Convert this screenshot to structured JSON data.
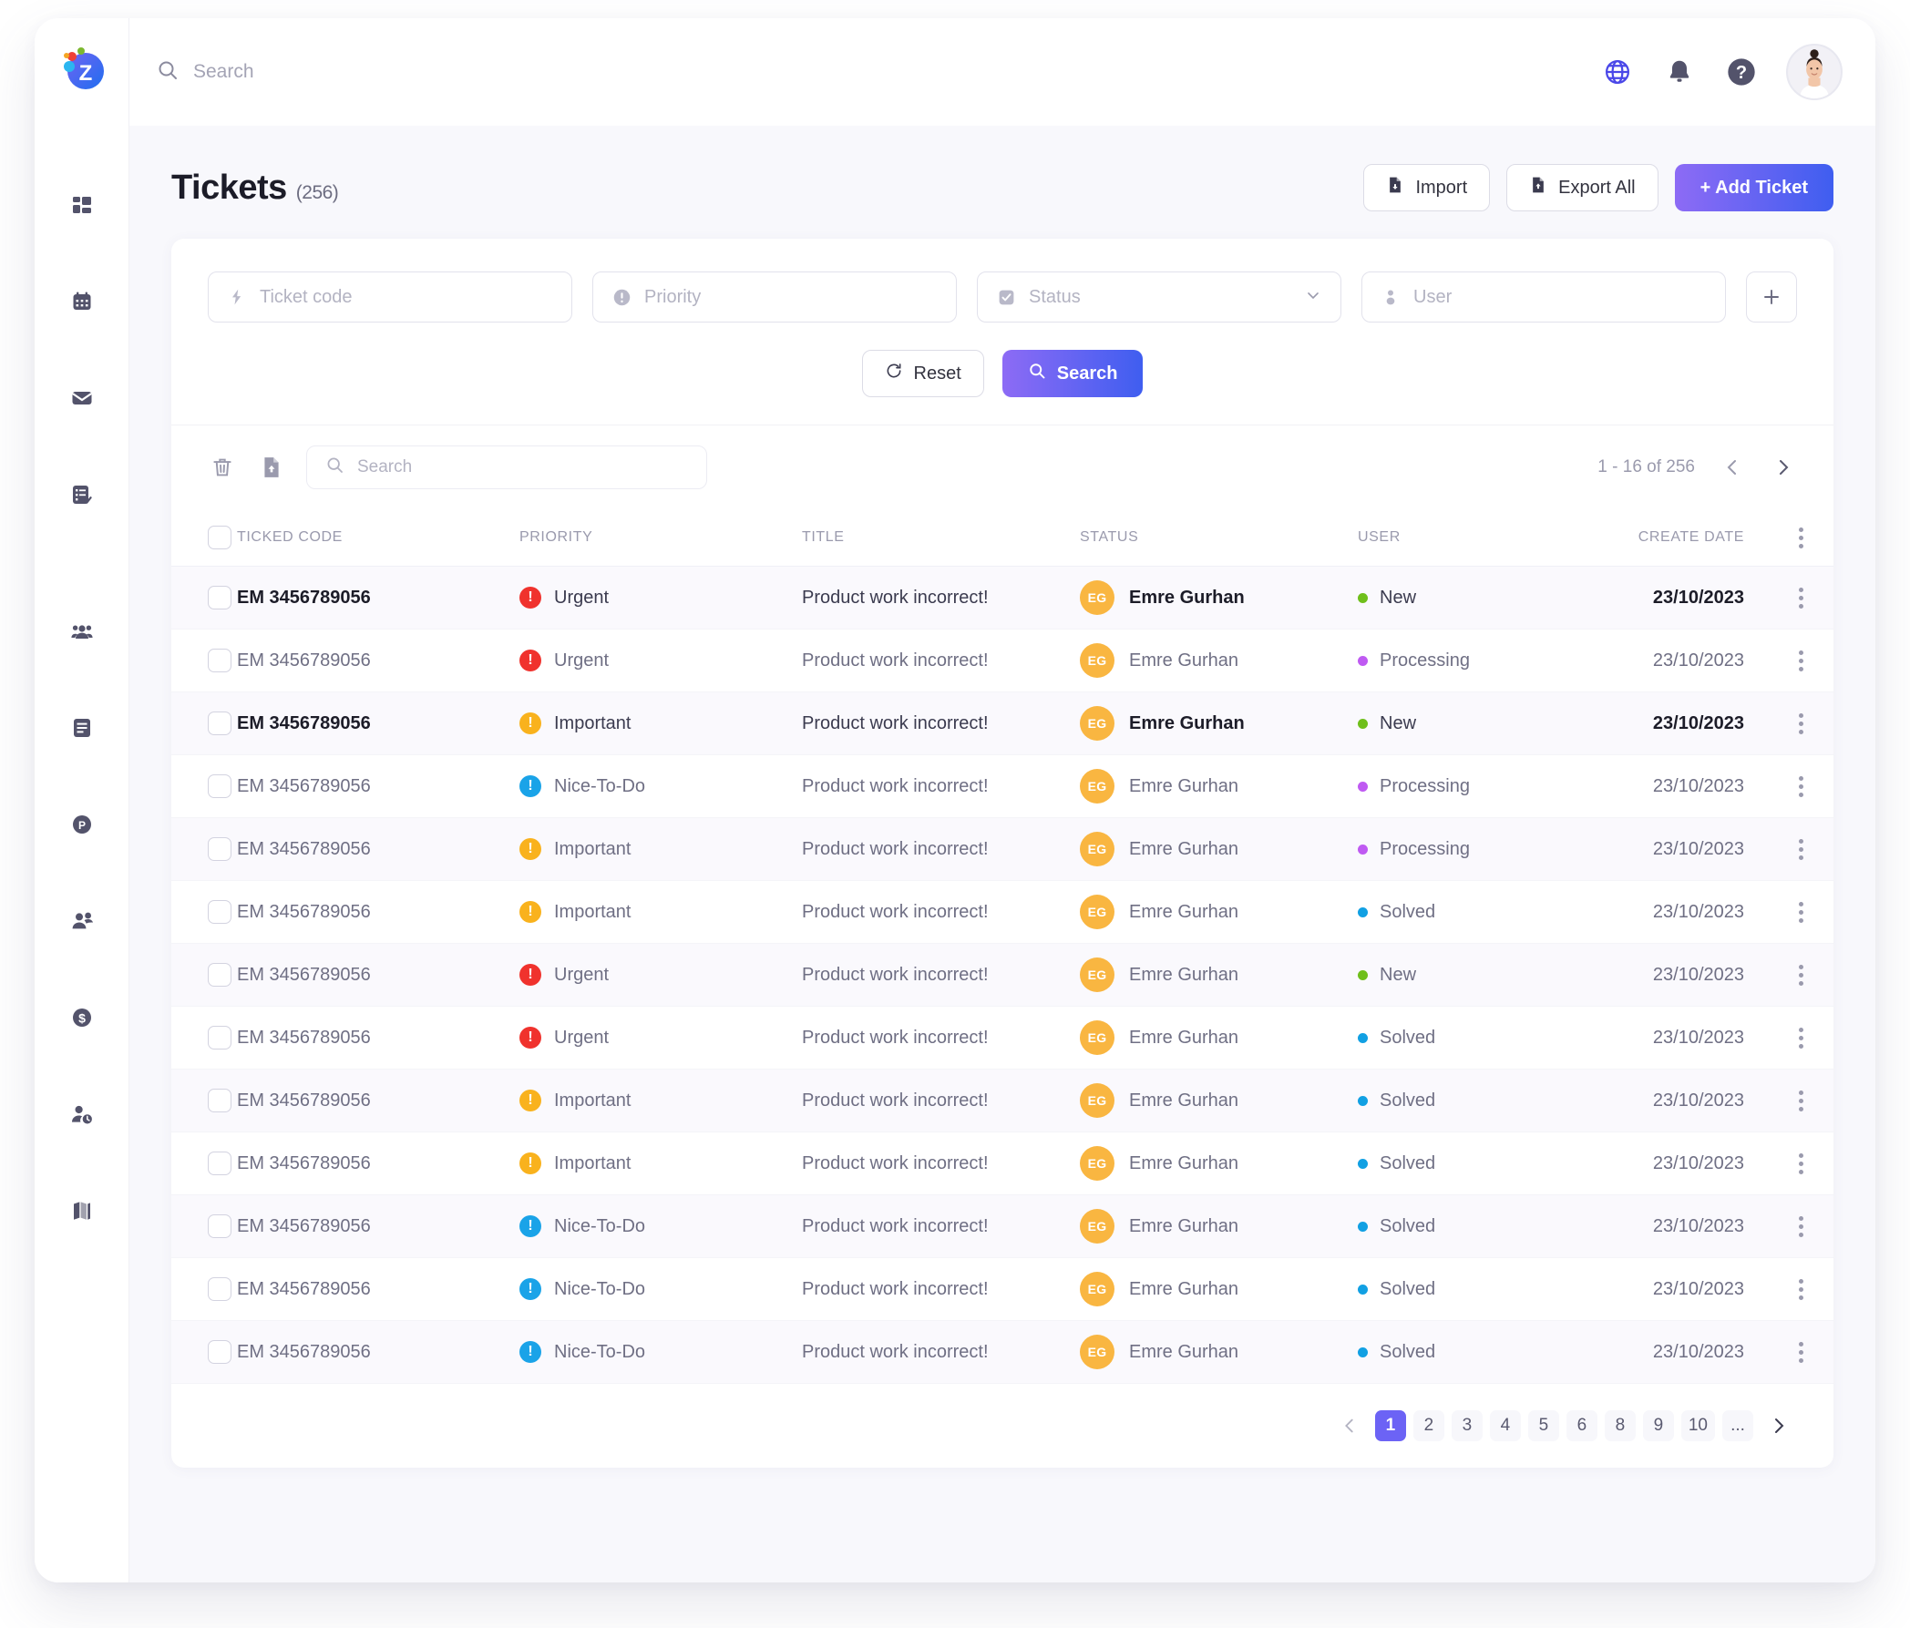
{
  "brand": {
    "logo_letter": "Z",
    "accent": "#3f5ef0",
    "accent2": "#8d6bf5"
  },
  "topbar": {
    "search_placeholder": "Search",
    "icons": [
      "globe-icon",
      "bell-icon",
      "help-icon"
    ]
  },
  "sidebar": {
    "items": [
      {
        "name": "dashboard",
        "icon": "dashboard-icon"
      },
      {
        "name": "calendar",
        "icon": "calendar-icon"
      },
      {
        "name": "mail",
        "icon": "mail-icon"
      },
      {
        "name": "tasks",
        "icon": "task-list-icon"
      },
      {
        "name": "teams",
        "icon": "users-group-icon"
      },
      {
        "name": "documents",
        "icon": "document-icon"
      },
      {
        "name": "projects",
        "icon": "p-circle-icon"
      },
      {
        "name": "contacts",
        "icon": "user-add-icon"
      },
      {
        "name": "finance",
        "icon": "dollar-circle-icon"
      },
      {
        "name": "user-settings",
        "icon": "user-clock-icon"
      },
      {
        "name": "map",
        "icon": "map-icon"
      }
    ]
  },
  "page": {
    "title": "Tickets",
    "count": "(256)",
    "import_label": "Import",
    "export_label": "Export All",
    "add_label": "+ Add Ticket"
  },
  "filters": {
    "ticket_code_placeholder": "Ticket code",
    "priority_placeholder": "Priority",
    "status_placeholder": "Status",
    "user_placeholder": "User",
    "add_filter_label": "+",
    "reset_label": "Reset",
    "search_label": "Search"
  },
  "table_toolbar": {
    "search_placeholder": "Search",
    "range_text": "1 - 16 of 256"
  },
  "table": {
    "headers": [
      "TICKED CODE",
      "PRIORITY",
      "TITLE",
      "STATUS",
      "USER",
      "CREATE DATE"
    ],
    "priority_colors": {
      "Urgent": "#f0322d",
      "Important": "#f9b21d",
      "Nice-To-Do": "#1aa3e8"
    },
    "status_colors": {
      "New": "#6fbf1b",
      "Processing": "#bf5af2",
      "Solved": "#11a0e3"
    },
    "rows": [
      {
        "code": "EM 3456789056",
        "priority": "Urgent",
        "title": "Product work incorrect!",
        "user": "Emre Gurhan",
        "initials": "EG",
        "status": "New",
        "date": "23/10/2023",
        "bold": true,
        "alt": true
      },
      {
        "code": "EM 3456789056",
        "priority": "Urgent",
        "title": "Product work incorrect!",
        "user": "Emre Gurhan",
        "initials": "EG",
        "status": "Processing",
        "date": "23/10/2023",
        "bold": false,
        "alt": false
      },
      {
        "code": "EM 3456789056",
        "priority": "Important",
        "title": "Product work incorrect!",
        "user": "Emre Gurhan",
        "initials": "EG",
        "status": "New",
        "date": "23/10/2023",
        "bold": true,
        "alt": true
      },
      {
        "code": "EM 3456789056",
        "priority": "Nice-To-Do",
        "title": "Product work incorrect!",
        "user": "Emre Gurhan",
        "initials": "EG",
        "status": "Processing",
        "date": "23/10/2023",
        "bold": false,
        "alt": false
      },
      {
        "code": "EM 3456789056",
        "priority": "Important",
        "title": "Product work incorrect!",
        "user": "Emre Gurhan",
        "initials": "EG",
        "status": "Processing",
        "date": "23/10/2023",
        "bold": false,
        "alt": true
      },
      {
        "code": "EM 3456789056",
        "priority": "Important",
        "title": "Product work incorrect!",
        "user": "Emre Gurhan",
        "initials": "EG",
        "status": "Solved",
        "date": "23/10/2023",
        "bold": false,
        "alt": false
      },
      {
        "code": "EM 3456789056",
        "priority": "Urgent",
        "title": "Product work incorrect!",
        "user": "Emre Gurhan",
        "initials": "EG",
        "status": "New",
        "date": "23/10/2023",
        "bold": false,
        "alt": true
      },
      {
        "code": "EM 3456789056",
        "priority": "Urgent",
        "title": "Product work incorrect!",
        "user": "Emre Gurhan",
        "initials": "EG",
        "status": "Solved",
        "date": "23/10/2023",
        "bold": false,
        "alt": false
      },
      {
        "code": "EM 3456789056",
        "priority": "Important",
        "title": "Product work incorrect!",
        "user": "Emre Gurhan",
        "initials": "EG",
        "status": "Solved",
        "date": "23/10/2023",
        "bold": false,
        "alt": true
      },
      {
        "code": "EM 3456789056",
        "priority": "Important",
        "title": "Product work incorrect!",
        "user": "Emre Gurhan",
        "initials": "EG",
        "status": "Solved",
        "date": "23/10/2023",
        "bold": false,
        "alt": false
      },
      {
        "code": "EM 3456789056",
        "priority": "Nice-To-Do",
        "title": "Product work incorrect!",
        "user": "Emre Gurhan",
        "initials": "EG",
        "status": "Solved",
        "date": "23/10/2023",
        "bold": false,
        "alt": true
      },
      {
        "code": "EM 3456789056",
        "priority": "Nice-To-Do",
        "title": "Product work incorrect!",
        "user": "Emre Gurhan",
        "initials": "EG",
        "status": "Solved",
        "date": "23/10/2023",
        "bold": false,
        "alt": false
      },
      {
        "code": "EM 3456789056",
        "priority": "Nice-To-Do",
        "title": "Product work incorrect!",
        "user": "Emre Gurhan",
        "initials": "EG",
        "status": "Solved",
        "date": "23/10/2023",
        "bold": false,
        "alt": true
      }
    ]
  },
  "pagination": {
    "pages": [
      "1",
      "2",
      "3",
      "4",
      "5",
      "6",
      "8",
      "9",
      "10",
      "..."
    ],
    "active": "1"
  }
}
